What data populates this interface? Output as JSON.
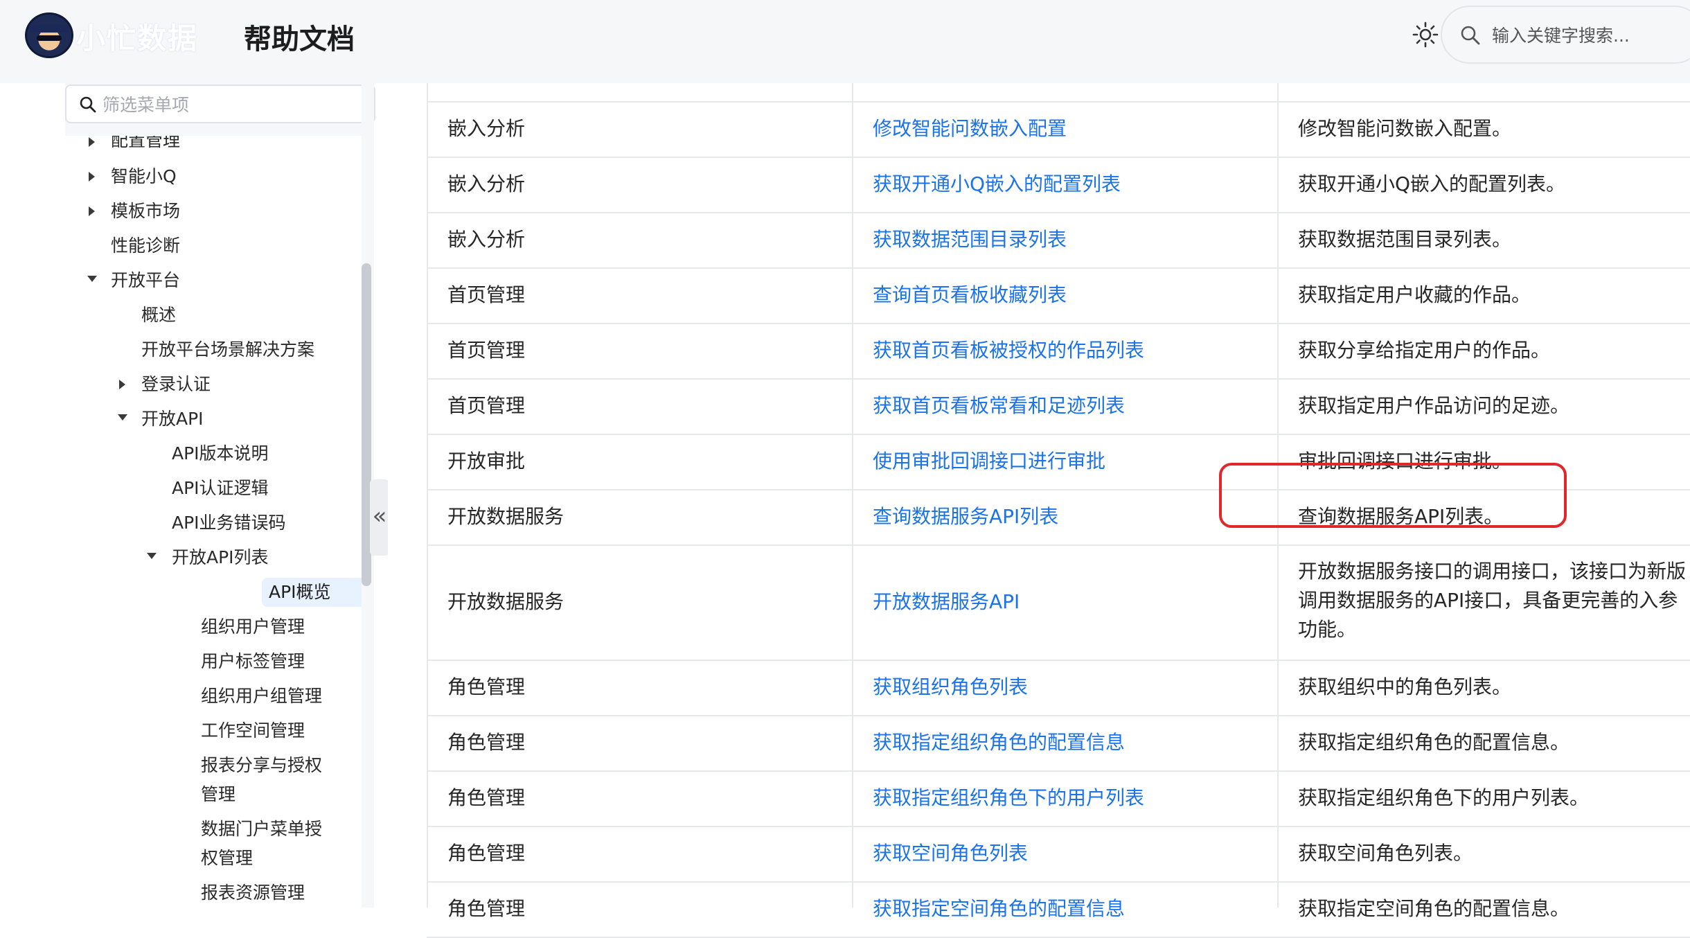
{
  "header": {
    "brand": "小忙数据",
    "title": "帮助文档",
    "search_placeholder": "输入关键字搜索..."
  },
  "sidebar": {
    "filter_placeholder": "筛选菜单项",
    "items": [
      {
        "label": "配置管理"
      },
      {
        "label": "智能小Q"
      },
      {
        "label": "模板市场"
      },
      {
        "label": "性能诊断"
      },
      {
        "label": "开放平台"
      },
      {
        "label": "概述"
      },
      {
        "label": "开放平台场景解决方案"
      },
      {
        "label": "登录认证"
      },
      {
        "label": "开放API"
      },
      {
        "label": "API版本说明"
      },
      {
        "label": "API认证逻辑"
      },
      {
        "label": "API业务错误码"
      },
      {
        "label": "开放API列表"
      },
      {
        "label": "API概览"
      },
      {
        "label": "组织用户管理"
      },
      {
        "label": "用户标签管理"
      },
      {
        "label": "组织用户组管理"
      },
      {
        "label": "工作空间管理"
      },
      {
        "label": "报表分享与授权管理"
      },
      {
        "label": "数据门户菜单授权管理"
      },
      {
        "label": "报表资源管理"
      }
    ]
  },
  "table": {
    "rows": [
      {
        "category": "嵌入分析",
        "api": "修改智能问数嵌入配置",
        "desc": "修改智能问数嵌入配置。"
      },
      {
        "category": "嵌入分析",
        "api": "获取开通小Q嵌入的配置列表",
        "desc": "获取开通小Q嵌入的配置列表。"
      },
      {
        "category": "嵌入分析",
        "api": "获取数据范围目录列表",
        "desc": "获取数据范围目录列表。"
      },
      {
        "category": "首页管理",
        "api": "查询首页看板收藏列表",
        "desc": "获取指定用户收藏的作品。"
      },
      {
        "category": "首页管理",
        "api": "获取首页看板被授权的作品列表",
        "desc": "获取分享给指定用户的作品。"
      },
      {
        "category": "首页管理",
        "api": "获取首页看板常看和足迹列表",
        "desc": "获取指定用户作品访问的足迹。"
      },
      {
        "category": "开放审批",
        "api": "使用审批回调接口进行审批",
        "desc": "审批回调接口进行审批。"
      },
      {
        "category": "开放数据服务",
        "api": "查询数据服务API列表",
        "desc": "查询数据服务API列表。"
      },
      {
        "category": "开放数据服务",
        "api": "开放数据服务API",
        "desc": "开放数据服务接口的调用接口，该接口为新版调用数据服务的API接口，具备更完善的入参功能。"
      },
      {
        "category": "角色管理",
        "api": "获取组织角色列表",
        "desc": "获取组织中的角色列表。"
      },
      {
        "category": "角色管理",
        "api": "获取指定组织角色的配置信息",
        "desc": "获取指定组织角色的配置信息。"
      },
      {
        "category": "角色管理",
        "api": "获取指定组织角色下的用户列表",
        "desc": "获取指定组织角色下的用户列表。"
      },
      {
        "category": "角色管理",
        "api": "获取空间角色列表",
        "desc": "获取空间角色列表。"
      },
      {
        "category": "角色管理",
        "api": "获取指定空间角色的配置信息",
        "desc": "获取指定空间角色的配置信息。"
      }
    ]
  }
}
